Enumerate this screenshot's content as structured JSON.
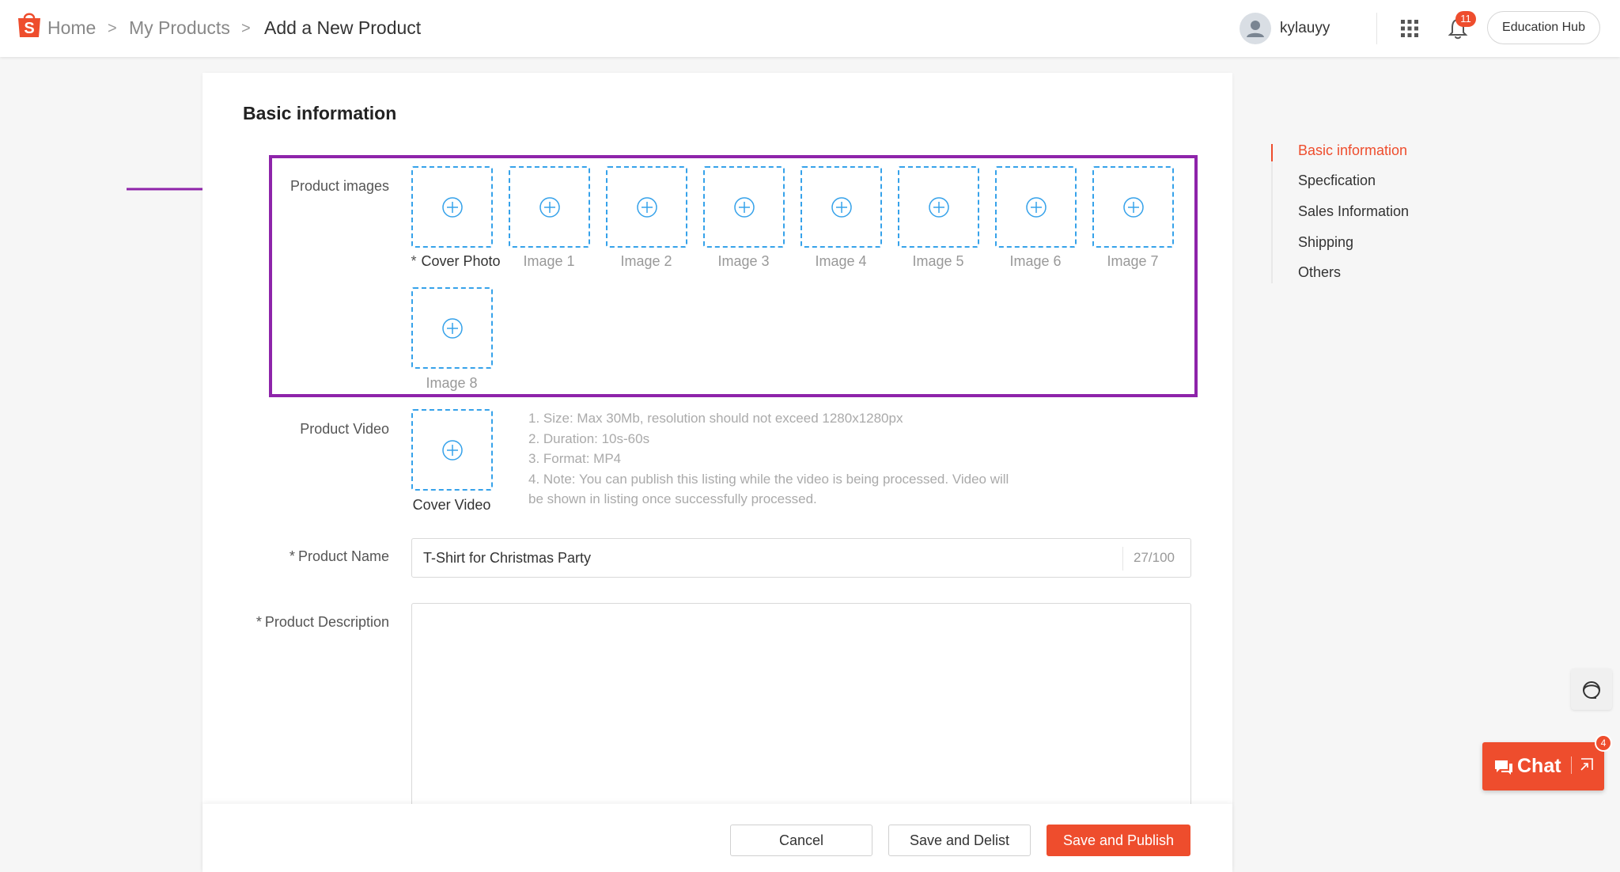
{
  "breadcrumb": {
    "home": "Home",
    "my_products": "My Products",
    "current": "Add a New Product",
    "separator": ">"
  },
  "header": {
    "username": "kylauyy",
    "notification_count": "11",
    "education_hub": "Education Hub"
  },
  "main": {
    "section_title": "Basic information",
    "product_images": {
      "label": "Product images",
      "required_mark": "*",
      "slots": [
        {
          "caption": "Cover Photo"
        },
        {
          "caption": "Image 1"
        },
        {
          "caption": "Image 2"
        },
        {
          "caption": "Image 3"
        },
        {
          "caption": "Image 4"
        },
        {
          "caption": "Image 5"
        },
        {
          "caption": "Image 6"
        },
        {
          "caption": "Image 7"
        },
        {
          "caption": "Image 8"
        }
      ]
    },
    "product_video": {
      "label": "Product Video",
      "caption": "Cover Video",
      "hints": [
        "1. Size: Max 30Mb, resolution should not exceed 1280x1280px",
        "2. Duration: 10s-60s",
        "3. Format: MP4",
        "4. Note: You can publish this listing while the video is being processed. Video will be shown in listing once successfully processed."
      ]
    },
    "product_name": {
      "required_mark": "*",
      "label": "Product Name",
      "value": "T-Shirt for Christmas Party",
      "counter": "27/100"
    },
    "product_description": {
      "required_mark": "*",
      "label": "Product Description",
      "value": ""
    }
  },
  "footer": {
    "cancel": "Cancel",
    "save_delist": "Save and Delist",
    "save_publish": "Save and Publish"
  },
  "side_nav": {
    "items": [
      {
        "label": "Basic information",
        "active": true
      },
      {
        "label": "Specfication",
        "active": false
      },
      {
        "label": "Sales Information",
        "active": false
      },
      {
        "label": "Shipping",
        "active": false
      },
      {
        "label": "Others",
        "active": false
      }
    ]
  },
  "chat": {
    "label": "Chat",
    "badge": "4"
  },
  "colors": {
    "brand": "#ee4d2d",
    "upload_border": "#36a2ea",
    "annotation": "#8e24aa"
  },
  "icons": {
    "logo": "shopee-bag-icon",
    "apps": "apps-grid-icon",
    "notifications": "bell-icon",
    "upload": "plus-circle-icon",
    "support": "headset-icon",
    "chat": "chat-bubble-icon",
    "annotation_arrow": "arrow-right-icon"
  }
}
